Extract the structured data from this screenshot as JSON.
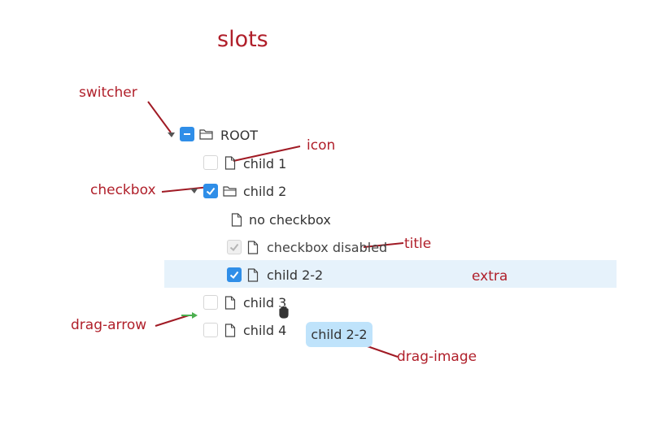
{
  "title": "slots",
  "annotations": {
    "switcher": "switcher",
    "icon": "icon",
    "checkbox": "checkbox",
    "title": "title",
    "extra": "extra",
    "drag_arrow": "drag-arrow",
    "drag_image": "drag-image"
  },
  "tree": {
    "root": "ROOT",
    "child1": "child 1",
    "child2": "child 2",
    "no_checkbox": "no checkbox",
    "checkbox_disabled": "checkbox disabled",
    "child2_2": "child 2-2",
    "child3": "child 3",
    "child4": "child 4"
  },
  "drag_image_label": "child 2-2",
  "colors": {
    "annotation": "#b01f2a",
    "checkbox_checked": "#2f8ee8",
    "selected_row": "#e6f2fb",
    "drag_image": "#bfe3fb",
    "drag_arrow": "#4caf50"
  },
  "icons": {
    "root": "folder-icon",
    "child2": "folder-icon",
    "leaf": "file-icon",
    "cursor": "grab-hand-icon"
  }
}
